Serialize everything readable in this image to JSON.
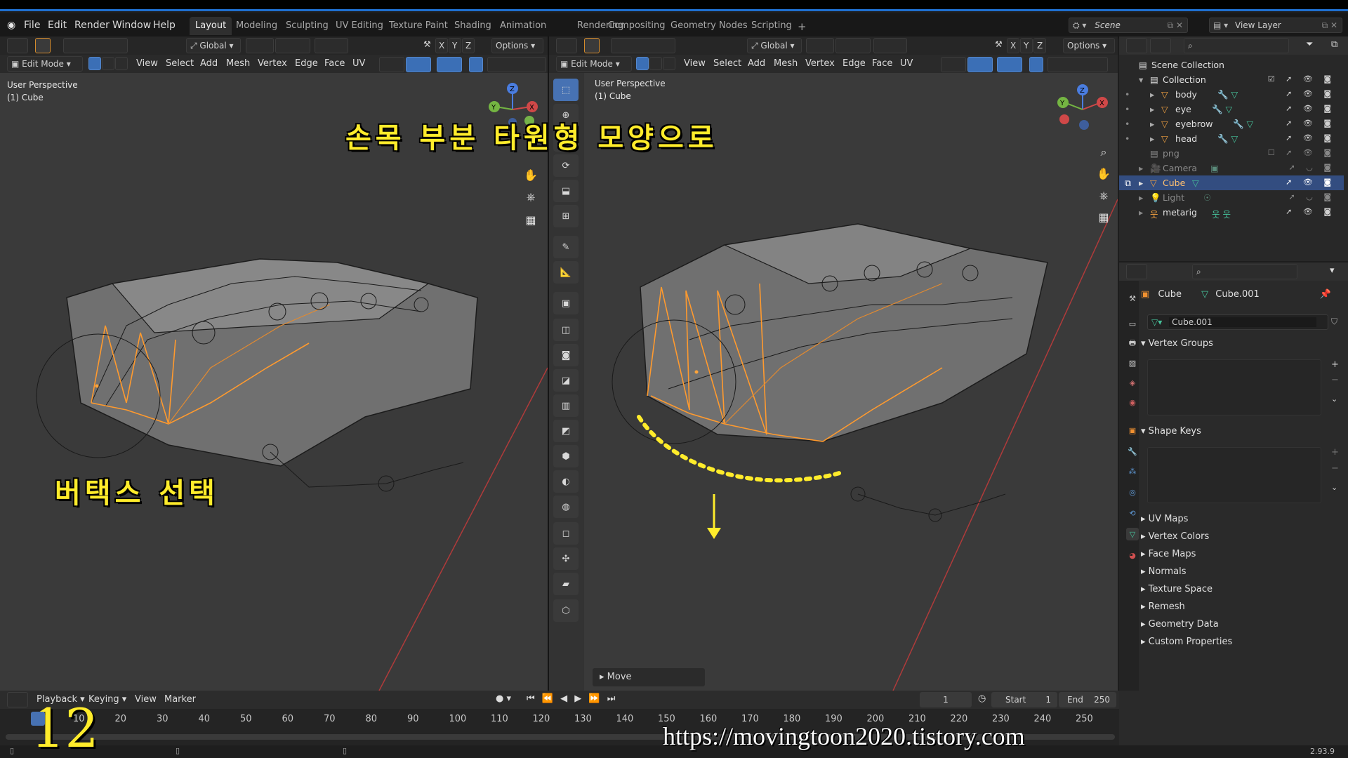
{
  "menubar": {
    "items": [
      "File",
      "Edit",
      "Render",
      "Window",
      "Help"
    ],
    "workspaces": [
      "Layout",
      "Modeling",
      "Sculpting",
      "UV Editing",
      "Texture Paint",
      "Shading",
      "Animation",
      "Rendering",
      "Compositing",
      "Geometry Nodes",
      "Scripting"
    ],
    "add_tab": "+",
    "scene": "Scene",
    "view_layer": "View Layer"
  },
  "left_header": {
    "orientation": "Global",
    "options": "Options",
    "axes": [
      "X",
      "Y",
      "Z"
    ]
  },
  "left_menu": {
    "mode": "Edit Mode",
    "items": [
      "View",
      "Select",
      "Add",
      "Mesh",
      "Vertex",
      "Edge",
      "Face",
      "UV"
    ]
  },
  "left_viewport": {
    "perspective": "User Perspective",
    "object": "(1) Cube",
    "gizmo": {
      "x": "X",
      "y": "Y",
      "z": "Z"
    }
  },
  "right_header": {
    "orientation": "Global",
    "options": "Options",
    "axes": [
      "X",
      "Y",
      "Z"
    ]
  },
  "right_menu": {
    "mode": "Edit Mode",
    "items": [
      "View",
      "Select",
      "Add",
      "Mesh",
      "Vertex",
      "Edge",
      "Face",
      "UV"
    ]
  },
  "right_viewport": {
    "perspective": "User Perspective",
    "object": "(1) Cube",
    "last_operator": "Move",
    "gizmo": {
      "x": "X",
      "y": "Y",
      "z": "Z"
    }
  },
  "overlays": {
    "title_ko": "손목 부분 타원형 모양으로",
    "select_ko": "버택스 선택",
    "step_number": "12",
    "watermark": "https://movingtoon2020.tistory.com"
  },
  "outliner": {
    "rows": [
      {
        "label": "Scene Collection",
        "indent": 0
      },
      {
        "label": "Collection",
        "indent": 1
      },
      {
        "label": "body",
        "indent": 2
      },
      {
        "label": "eye",
        "indent": 2
      },
      {
        "label": "eyebrow",
        "indent": 2
      },
      {
        "label": "head",
        "indent": 2
      },
      {
        "label": "png",
        "indent": 1
      },
      {
        "label": "Camera",
        "indent": 1
      },
      {
        "label": "Cube",
        "indent": 1
      },
      {
        "label": "Light",
        "indent": 1
      },
      {
        "label": "metarig",
        "indent": 1
      }
    ]
  },
  "properties": {
    "object": "Cube",
    "mesh": "Cube.001",
    "mesh_field": "Cube.001",
    "sections": {
      "vertex_groups": "Vertex Groups",
      "shape_keys": "Shape Keys",
      "uv_maps": "UV Maps",
      "vertex_colors": "Vertex Colors",
      "face_maps": "Face Maps",
      "normals": "Normals",
      "texture_space": "Texture Space",
      "remesh": "Remesh",
      "geometry_data": "Geometry Data",
      "custom_properties": "Custom Properties"
    }
  },
  "timeline": {
    "menu": [
      "Playback",
      "Keying",
      "View",
      "Marker"
    ],
    "current_frame": "1",
    "start_label": "Start",
    "start": "1",
    "end_label": "End",
    "end": "250",
    "ticks": [
      "10",
      "20",
      "30",
      "40",
      "50",
      "60",
      "70",
      "80",
      "90",
      "100",
      "110",
      "120",
      "130",
      "140",
      "150",
      "160",
      "170",
      "180",
      "190",
      "200",
      "210",
      "220",
      "230",
      "240",
      "250"
    ]
  },
  "status": {
    "version": "2.93.9"
  },
  "colors": {
    "accent": "#4772b3",
    "selection_edge": "#ff9a2e",
    "overlay_text": "#ffec2b",
    "axis_red": "#c0392b"
  }
}
